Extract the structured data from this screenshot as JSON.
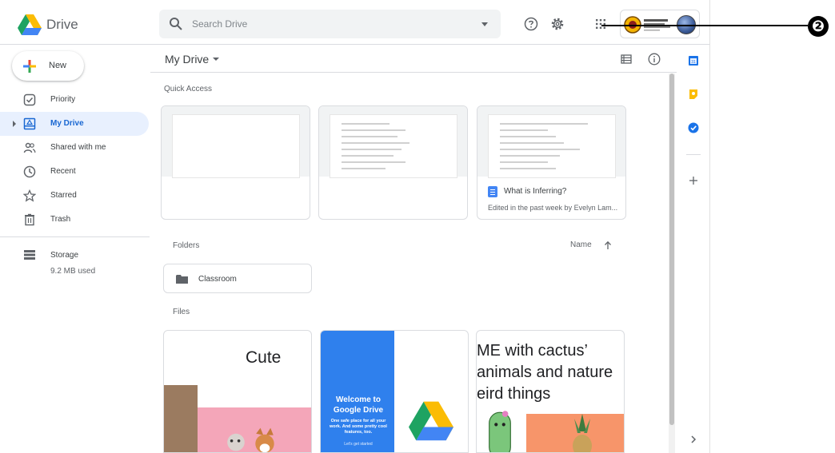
{
  "app": {
    "brand": "Drive"
  },
  "search": {
    "placeholder": "Search Drive"
  },
  "sidebar": {
    "new_label": "New",
    "items": [
      {
        "label": "Priority",
        "icon": "priority-icon"
      },
      {
        "label": "My Drive",
        "icon": "my-drive-icon",
        "active": true
      },
      {
        "label": "Shared with me",
        "icon": "shared-icon"
      },
      {
        "label": "Recent",
        "icon": "clock-icon"
      },
      {
        "label": "Starred",
        "icon": "star-icon"
      },
      {
        "label": "Trash",
        "icon": "trash-icon"
      }
    ],
    "storage_label": "Storage",
    "storage_used": "9.2 MB used"
  },
  "main": {
    "title": "My Drive",
    "quick_access_label": "Quick Access",
    "quick_access": [
      {
        "title": "",
        "subtitle": ""
      },
      {
        "title": "",
        "subtitle": ""
      },
      {
        "title": "What is Inferring?",
        "subtitle": "Edited in the past week by Evelyn Lam..."
      }
    ],
    "folders_label": "Folders",
    "sort_label": "Name",
    "folders": [
      {
        "name": "Classroom"
      }
    ],
    "files_label": "Files",
    "files": [
      {
        "heading": "Cute"
      },
      {
        "heading": "Welcome to Google Drive",
        "body": "One safe place for all your work. And some pretty cool features, too.",
        "cta": "Let's get started"
      },
      {
        "lines": [
          "ME with cactus’",
          "animals and nature",
          "eird things"
        ]
      }
    ]
  },
  "annotation": {
    "badge": "❷"
  },
  "colors": {
    "accent_blue": "#1967d2",
    "active_bg": "#e8f0fe",
    "welcome_blue": "#2f80ed",
    "pink": "#f4a6b9",
    "orange": "#f7956a",
    "cactus": "#7bc67b"
  }
}
